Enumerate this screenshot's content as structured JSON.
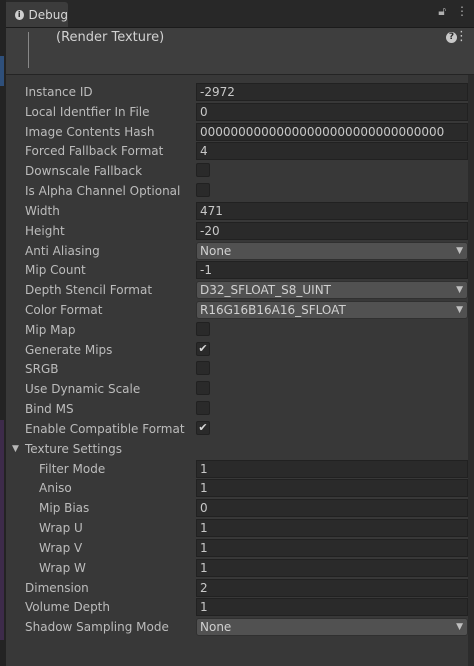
{
  "tab": {
    "icon": "info-icon",
    "label": "Debug",
    "lock_icon": "lock-icon",
    "menu_icon": "kebab-menu-icon"
  },
  "header": {
    "title": "(Render Texture)",
    "help_icon": "help-icon",
    "menu_icon": "kebab-menu-icon"
  },
  "rows": [
    {
      "label": "Instance ID",
      "type": "field",
      "value": "-2972"
    },
    {
      "label": "Local Identfier In File",
      "type": "field",
      "value": "0"
    },
    {
      "label": "Image Contents Hash",
      "type": "field",
      "value": "00000000000000000000000000000000"
    },
    {
      "label": "Forced Fallback Format",
      "type": "field",
      "value": "4"
    },
    {
      "label": "Downscale Fallback",
      "type": "checkbox",
      "checked": false
    },
    {
      "label": "Is Alpha Channel Optional",
      "type": "checkbox",
      "checked": false
    },
    {
      "label": "Width",
      "type": "field",
      "value": "471"
    },
    {
      "label": "Height",
      "type": "field",
      "value": "-20"
    },
    {
      "label": "Anti Aliasing",
      "type": "dropdown",
      "value": "None"
    },
    {
      "label": "Mip Count",
      "type": "field",
      "value": "-1"
    },
    {
      "label": "Depth Stencil Format",
      "type": "dropdown",
      "value": "D32_SFLOAT_S8_UINT"
    },
    {
      "label": "Color Format",
      "type": "dropdown",
      "value": "R16G16B16A16_SFLOAT"
    },
    {
      "label": "Mip Map",
      "type": "checkbox",
      "checked": false
    },
    {
      "label": "Generate Mips",
      "type": "checkbox",
      "checked": true
    },
    {
      "label": "SRGB",
      "type": "checkbox",
      "checked": false
    },
    {
      "label": "Use Dynamic Scale",
      "type": "checkbox",
      "checked": false
    },
    {
      "label": "Bind MS",
      "type": "checkbox",
      "checked": false
    },
    {
      "label": "Enable Compatible Format",
      "type": "checkbox",
      "checked": true
    },
    {
      "label": "Texture Settings",
      "type": "foldout",
      "expanded": true
    },
    {
      "label": "Filter Mode",
      "type": "field",
      "value": "1",
      "indent": true
    },
    {
      "label": "Aniso",
      "type": "field",
      "value": "1",
      "indent": true
    },
    {
      "label": "Mip Bias",
      "type": "field",
      "value": "0",
      "indent": true
    },
    {
      "label": "Wrap U",
      "type": "field",
      "value": "1",
      "indent": true
    },
    {
      "label": "Wrap V",
      "type": "field",
      "value": "1",
      "indent": true
    },
    {
      "label": "Wrap W",
      "type": "field",
      "value": "1",
      "indent": true
    },
    {
      "label": "Dimension",
      "type": "field",
      "value": "2"
    },
    {
      "label": "Volume Depth",
      "type": "field",
      "value": "1"
    },
    {
      "label": "Shadow Sampling Mode",
      "type": "dropdown",
      "value": "None"
    }
  ]
}
